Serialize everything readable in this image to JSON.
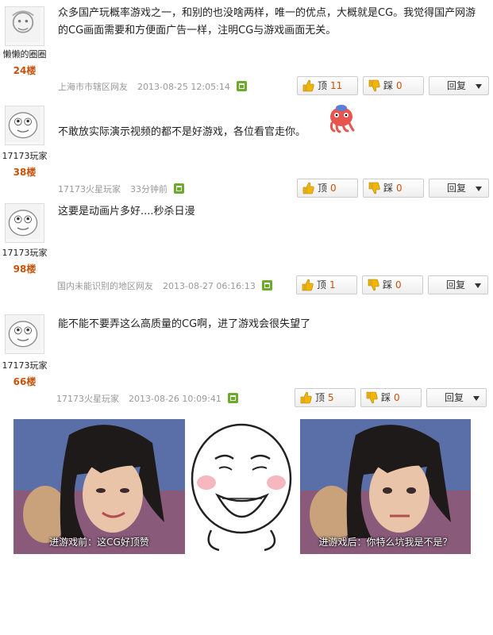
{
  "colors": {
    "accent": "#c8520a",
    "muted": "#999999",
    "trash": "#6caa2b"
  },
  "posts": [
    {
      "username": "懒懒的圈圈",
      "floor": "24楼",
      "text": "众多国产玩概率游戏之一，和别的也没啥两样，唯一的优点，大概就是CG。我觉得国产网游的CG画面需要和方便面广告一样，注明CG与游戏画面无关。",
      "location": "上海市市辖区网友",
      "time": "2013-08-25 12:05:14",
      "up_label": "顶",
      "up_count": "11",
      "down_label": "踩",
      "down_count": "0",
      "reply_label": "回复"
    },
    {
      "username": "17173玩家",
      "floor": "38楼",
      "text": "不敢放实际演示视频的都不是好游戏，各位看官走你。",
      "location": "17173火星玩家",
      "time": "33分钟前",
      "up_label": "顶",
      "up_count": "0",
      "down_label": "踩",
      "down_count": "0",
      "reply_label": "回复"
    },
    {
      "username": "17173玩家",
      "floor": "98楼",
      "text": "这要是动画片多好....秒杀日漫",
      "location": "国内未能识别的地区网友",
      "time": "2013-08-27 06:16:13",
      "up_label": "顶",
      "up_count": "1",
      "down_label": "踩",
      "down_count": "0",
      "reply_label": "回复"
    },
    {
      "username": "17173玩家",
      "floor": "66楼",
      "text": "能不能不要弄这么高质量的CG啊，进了游戏会很失望了",
      "location": "17173火星玩家",
      "time": "2013-08-26 10:09:41",
      "up_label": "顶",
      "up_count": "5",
      "down_label": "踩",
      "down_count": "0",
      "reply_label": "回复"
    }
  ],
  "meme": {
    "left_caption": "进游戏前：这CG好顶赞",
    "right_caption": "进游戏后：你特么坑我是不是？"
  }
}
